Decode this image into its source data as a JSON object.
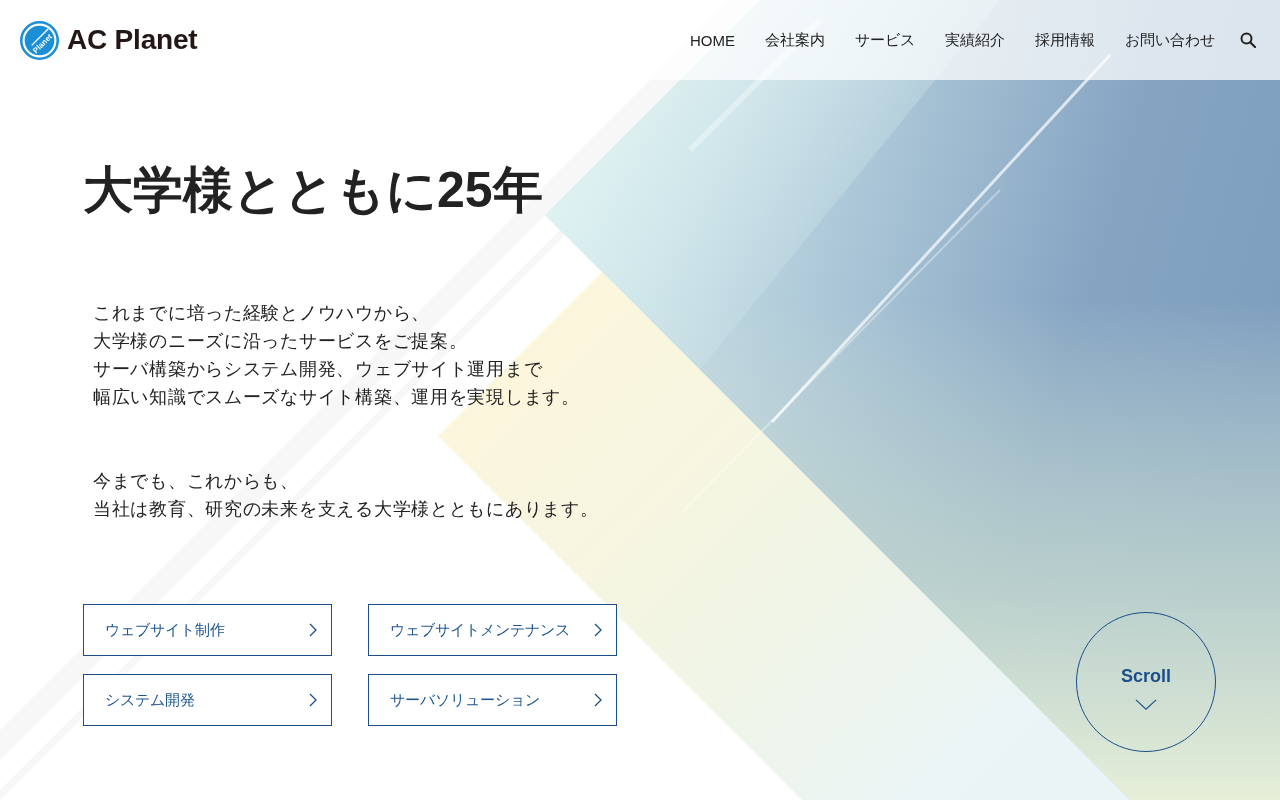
{
  "header": {
    "logo": {
      "mark_text": "Planet",
      "name": "AC Planet"
    },
    "nav": [
      "HOME",
      "会社案内",
      "サービス",
      "実績紹介",
      "採用情報",
      "お問い合わせ"
    ]
  },
  "hero": {
    "heading": "大学様とともに25年",
    "paragraphs": [
      [
        "これまでに培った経験とノウハウから、",
        "大学様のニーズに沿ったサービスをご提案。",
        "サーバ構築からシステム開発、ウェブサイト運用まで",
        "幅広い知識でスムーズなサイト構築、運用を実現します。"
      ],
      [
        "今までも、これからも、",
        "当社は教育、研究の未来を支える大学様とともにあります。"
      ]
    ]
  },
  "service_links": [
    "ウェブサイト制作",
    "ウェブサイトメンテナンス",
    "システム開発",
    "サーバソリューション"
  ],
  "scroll_indicator": {
    "label": "Scroll"
  }
}
